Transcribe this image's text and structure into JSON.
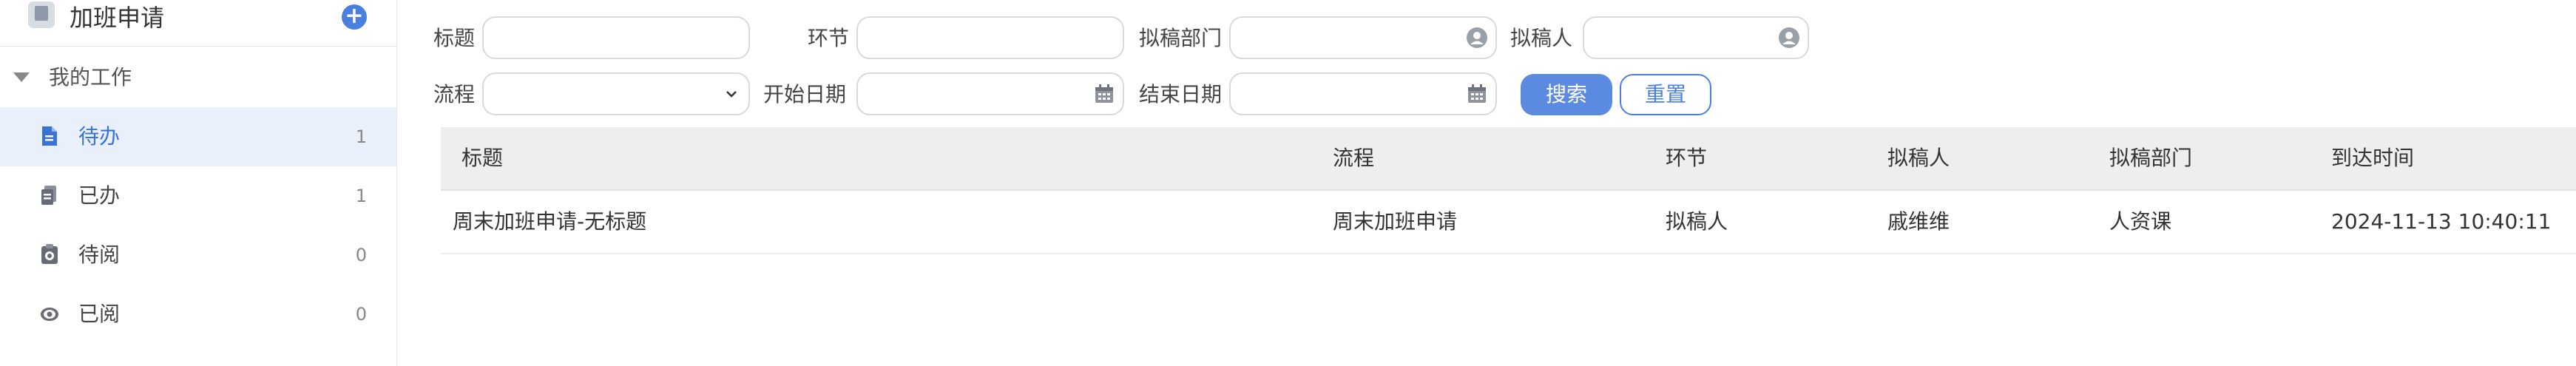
{
  "app": {
    "title": "加班申请",
    "add_icon": "plus-circle-icon"
  },
  "sidebar": {
    "group_label": "我的工作",
    "items": [
      {
        "label": "待办",
        "count": "1",
        "icon": "todo-doc-icon",
        "active": true
      },
      {
        "label": "已办",
        "count": "1",
        "icon": "done-doc-icon",
        "active": false
      },
      {
        "label": "待阅",
        "count": "0",
        "icon": "toread-icon",
        "active": false
      },
      {
        "label": "已阅",
        "count": "0",
        "icon": "read-eye-icon",
        "active": false
      }
    ]
  },
  "filters": {
    "title_label": "标题",
    "title_value": "",
    "step_label": "环节",
    "step_value": "",
    "dept_label": "拟稿部门",
    "dept_value": "",
    "drafter_label": "拟稿人",
    "drafter_value": "",
    "process_label": "流程",
    "process_value": "",
    "start_date_label": "开始日期",
    "start_date_value": "",
    "end_date_label": "结束日期",
    "end_date_value": "",
    "search_button": "搜索",
    "reset_button": "重置"
  },
  "table": {
    "columns": [
      "标题",
      "流程",
      "环节",
      "拟稿人",
      "拟稿部门",
      "到达时间"
    ],
    "rows": [
      [
        "周末加班申请-无标题",
        "周末加班申请",
        "拟稿人",
        "戚维维",
        "人资课",
        "2024-11-13 10:40:11"
      ]
    ]
  },
  "colors": {
    "accent": "#4a7fe0",
    "active_bg": "#eaf0fb",
    "header_bg": "#eeeeee"
  }
}
